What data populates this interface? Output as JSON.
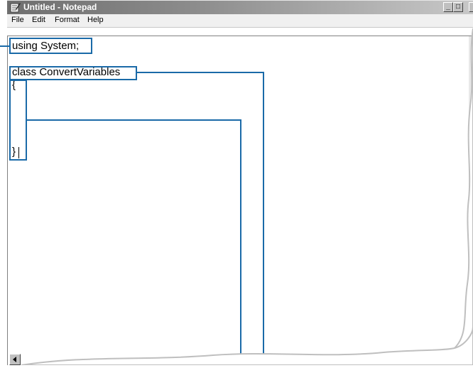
{
  "window": {
    "title": "Untitled - Notepad",
    "controls": {
      "minimize": "_",
      "maximize": "□"
    }
  },
  "menu": {
    "items": [
      "File",
      "Edit",
      "Format",
      "Help"
    ]
  },
  "editor": {
    "lines": [
      "using System;",
      "class ConvertVariables",
      "{",
      "}"
    ]
  },
  "colors": {
    "callout": "#1a6aa8",
    "title_gradient_start": "#6e6e6e",
    "title_gradient_end": "#c8c8c8",
    "torn_edge_shadow": "#bfbfbf"
  }
}
